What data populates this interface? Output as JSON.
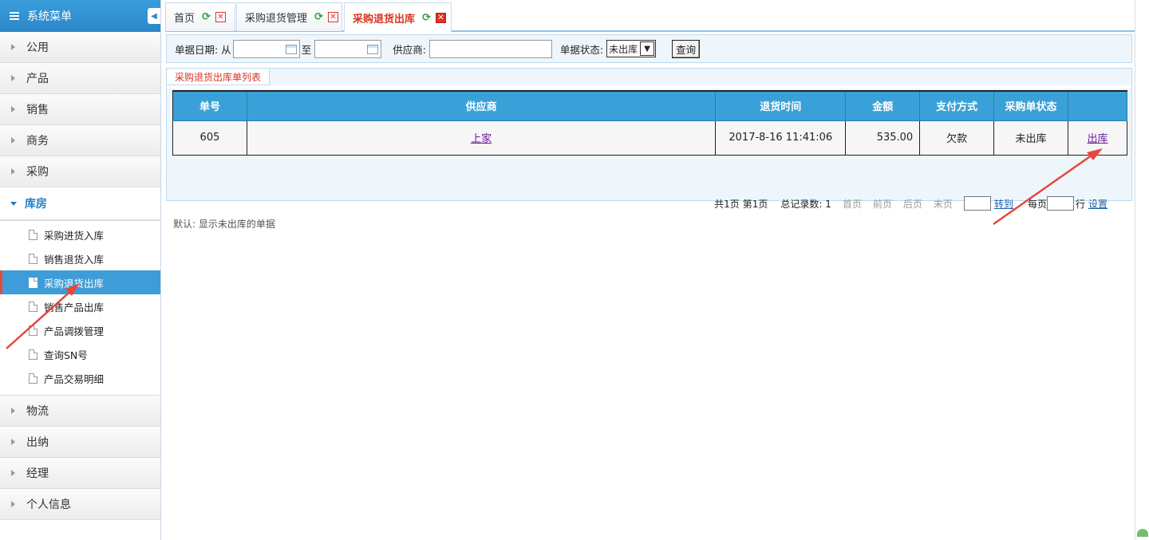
{
  "sidebar": {
    "title": "系统菜单",
    "groups_top": [
      {
        "label": "公用"
      },
      {
        "label": "产品"
      },
      {
        "label": "销售"
      },
      {
        "label": "商务"
      },
      {
        "label": "采购"
      }
    ],
    "open_group": {
      "label": "库房"
    },
    "sub_items": [
      {
        "label": "采购进货入库"
      },
      {
        "label": "销售退货入库"
      },
      {
        "label": "采购退货出库"
      },
      {
        "label": "销售产品出库"
      },
      {
        "label": "产品调拨管理"
      },
      {
        "label": "查询SN号"
      },
      {
        "label": "产品交易明细"
      }
    ],
    "groups_bottom": [
      {
        "label": "物流"
      },
      {
        "label": "出纳"
      },
      {
        "label": "经理"
      },
      {
        "label": "个人信息"
      }
    ]
  },
  "tabs": [
    {
      "label": "首页"
    },
    {
      "label": "采购退货管理"
    },
    {
      "label": "采购退货出库"
    }
  ],
  "filter": {
    "date_label": "单据日期: 从",
    "date_to_label": "至",
    "supplier_label": "供应商:",
    "status_label": "单据状态:",
    "status_value": "未出库",
    "query_button": "查询"
  },
  "list": {
    "tab_label": "采购退货出库单列表",
    "headers": [
      "单号",
      "供应商",
      "退货时间",
      "金额",
      "支付方式",
      "采购单状态",
      ""
    ],
    "rows": [
      {
        "id": "605",
        "supplier": "上家",
        "return_time": "2017-8-16 11:41:06",
        "amount": "535.00",
        "payment": "欠款",
        "status": "未出库",
        "action": "出库"
      }
    ]
  },
  "pager": {
    "total_pages": "共1页",
    "current_page": "第1页",
    "total_records": "总记录数: 1",
    "first": "首页",
    "prev": "前页",
    "next": "后页",
    "last": "末页",
    "goto": "转到",
    "per_page": "每页",
    "per_page_suffix": "行",
    "settings": "设置"
  },
  "hint": "默认: 显示未出库的单据",
  "colors": {
    "accent": "#3e9dd8",
    "header_blue": "#39a1d8",
    "active_tab_text": "#d9331f",
    "annotation_arrow": "#e8463a"
  }
}
